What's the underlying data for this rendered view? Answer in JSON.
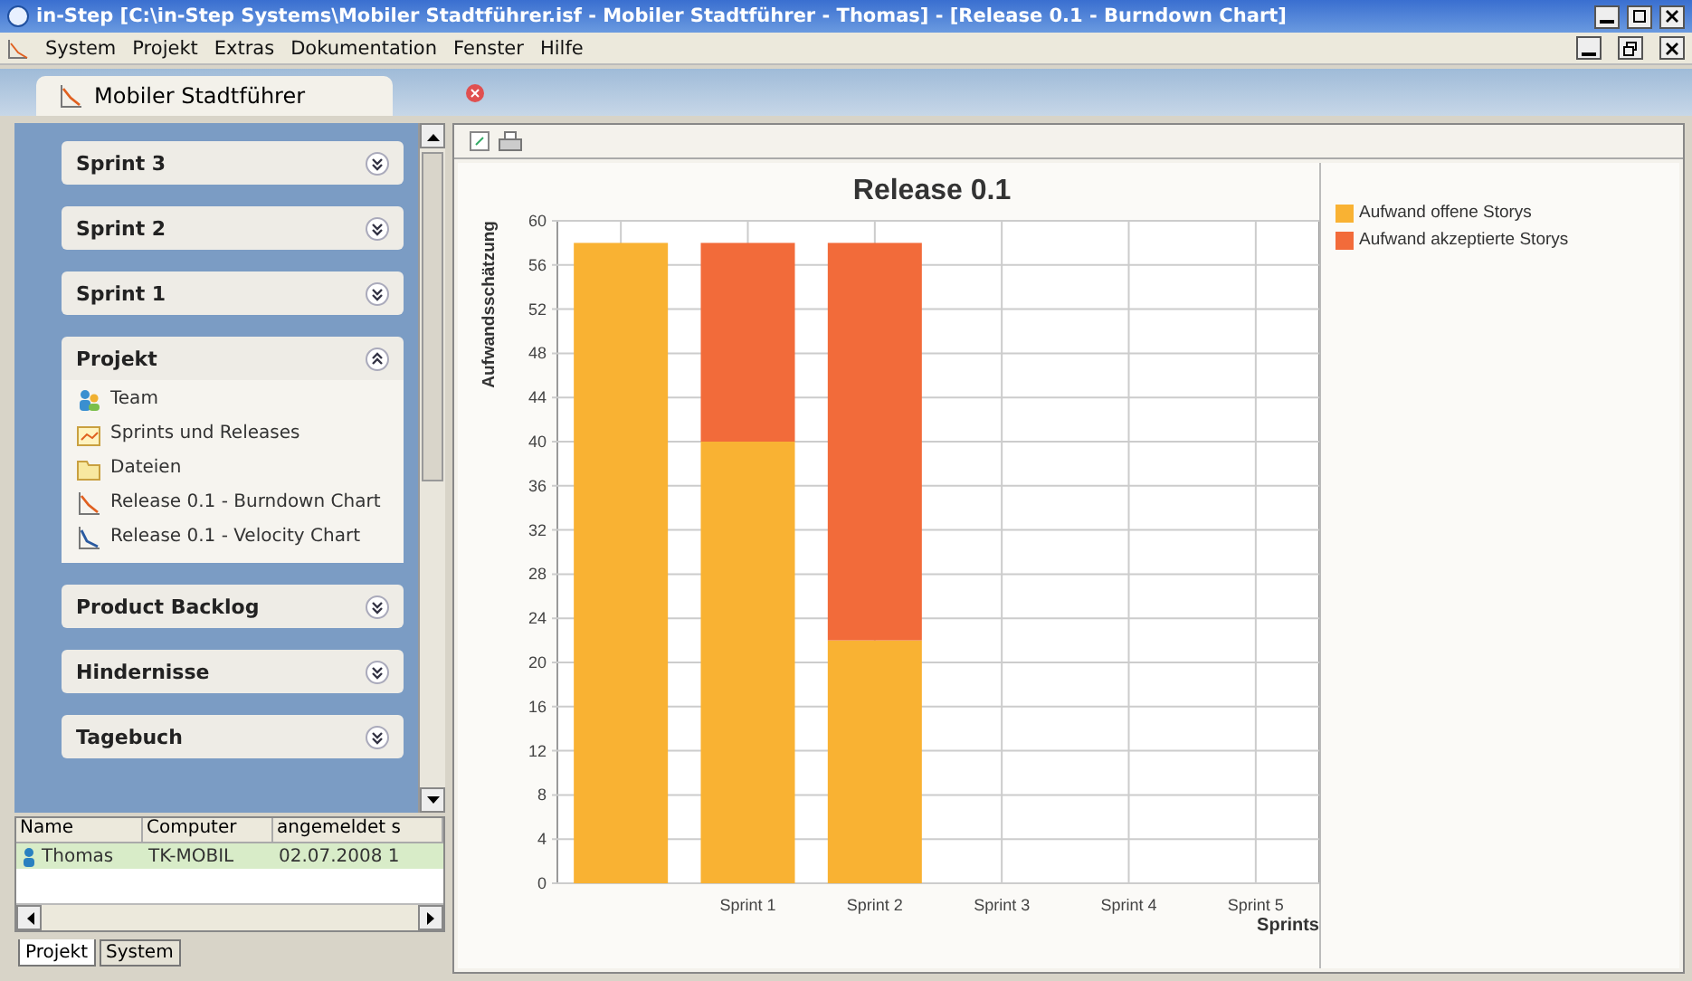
{
  "window": {
    "title": "in-Step  [C:\\in-Step Systems\\Mobiler Stadtführer.isf - Mobiler Stadtführer - Thomas] - [Release 0.1 - Burndown Chart]"
  },
  "menu": [
    "System",
    "Projekt",
    "Extras",
    "Dokumentation",
    "Fenster",
    "Hilfe"
  ],
  "document_tab": {
    "label": "Mobiler Stadtführer"
  },
  "sidebar": {
    "panels": [
      {
        "title": "Sprint 3",
        "expanded": false
      },
      {
        "title": "Sprint 2",
        "expanded": false
      },
      {
        "title": "Sprint 1",
        "expanded": false
      },
      {
        "title": "Projekt",
        "expanded": true,
        "items": [
          {
            "label": "Team",
            "kind": "team"
          },
          {
            "label": "Sprints und Releases",
            "kind": "sprints"
          },
          {
            "label": "Dateien",
            "kind": "folder"
          },
          {
            "label": "Release 0.1 - Burndown Chart",
            "kind": "burndown"
          },
          {
            "label": "Release 0.1 - Velocity Chart",
            "kind": "velocity"
          }
        ]
      },
      {
        "title": "Product Backlog",
        "expanded": false
      },
      {
        "title": "Hindernisse",
        "expanded": false
      },
      {
        "title": "Tagebuch",
        "expanded": false
      }
    ]
  },
  "users_table": {
    "columns": [
      "Name",
      "Computer",
      "angemeldet s"
    ],
    "rows": [
      {
        "cells": [
          "Thomas",
          "TK-MOBIL",
          "02.07.2008 1"
        ],
        "selected": true
      }
    ]
  },
  "bottom_tabs": [
    {
      "label": "Projekt",
      "selected": true
    },
    {
      "label": "System",
      "selected": false
    }
  ],
  "chart": {
    "chart_data": {
      "type": "bar",
      "stacked": true,
      "grid": true,
      "title": "Release 0.1",
      "xlabel": "Sprints",
      "ylabel": "Aufwandsschätzung",
      "categories": [
        null,
        "Sprint 1",
        "Sprint 2",
        "Sprint 3",
        "Sprint 4",
        "Sprint 5"
      ],
      "ylim": [
        0,
        60
      ],
      "yticks": [
        0,
        4,
        8,
        12,
        16,
        20,
        24,
        28,
        32,
        36,
        40,
        44,
        48,
        52,
        56,
        60
      ],
      "series": [
        {
          "name": "Aufwand offene Storys",
          "color": "#f9b233",
          "values": [
            58,
            40,
            22,
            null,
            null,
            null
          ]
        },
        {
          "name": "Aufwand akzeptierte Storys",
          "color": "#f26b3a",
          "values": [
            0,
            18,
            36,
            null,
            null,
            null
          ]
        }
      ]
    }
  }
}
